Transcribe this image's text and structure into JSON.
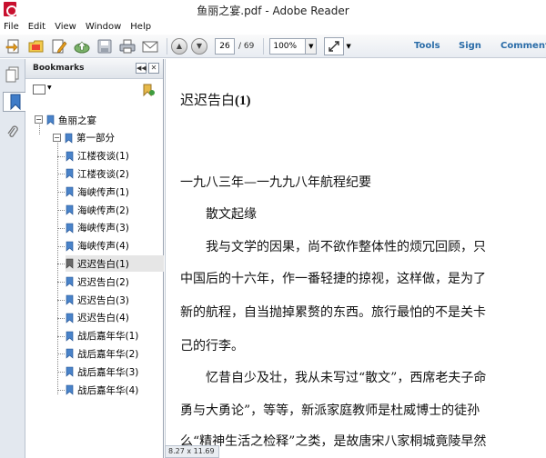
{
  "window": {
    "title": "鱼丽之宴.pdf - Adobe Reader"
  },
  "menu": [
    "File",
    "Edit",
    "View",
    "Window",
    "Help"
  ],
  "toolbar": {
    "current_page": "26",
    "total_pages": "/ 69",
    "zoom": "100%",
    "tools_label": "Tools",
    "sign_label": "Sign",
    "comment_label": "Comment"
  },
  "bookmarks": {
    "title": "Bookmarks",
    "tree": [
      {
        "label": "鱼丽之宴",
        "level": 0,
        "expandable": true,
        "selected": false
      },
      {
        "label": "第一部分",
        "level": 1,
        "expandable": true,
        "selected": false
      },
      {
        "label": "江楼夜谈(1)",
        "level": 2,
        "expandable": false,
        "selected": false
      },
      {
        "label": "江楼夜谈(2)",
        "level": 2,
        "expandable": false,
        "selected": false
      },
      {
        "label": "海峡传声(1)",
        "level": 2,
        "expandable": false,
        "selected": false
      },
      {
        "label": "海峡传声(2)",
        "level": 2,
        "expandable": false,
        "selected": false
      },
      {
        "label": "海峡传声(3)",
        "level": 2,
        "expandable": false,
        "selected": false
      },
      {
        "label": "海峡传声(4)",
        "level": 2,
        "expandable": false,
        "selected": false
      },
      {
        "label": "迟迟告白(1)",
        "level": 2,
        "expandable": false,
        "selected": true
      },
      {
        "label": "迟迟告白(2)",
        "level": 2,
        "expandable": false,
        "selected": false
      },
      {
        "label": "迟迟告白(3)",
        "level": 2,
        "expandable": false,
        "selected": false
      },
      {
        "label": "迟迟告白(4)",
        "level": 2,
        "expandable": false,
        "selected": false
      },
      {
        "label": "战后嘉年华(1)",
        "level": 2,
        "expandable": false,
        "selected": false
      },
      {
        "label": "战后嘉年华(2)",
        "level": 2,
        "expandable": false,
        "selected": false
      },
      {
        "label": "战后嘉年华(3)",
        "level": 2,
        "expandable": false,
        "selected": false
      },
      {
        "label": "战后嘉年华(4)",
        "level": 2,
        "expandable": false,
        "selected": false
      }
    ]
  },
  "document": {
    "heading_text": "迟迟告白",
    "heading_num": "(1)",
    "lines": [
      "一九八三年—一九九八年航程纪要",
      "　　散文起缘",
      "　　我与文学的因果，尚不欲作整体性的烦冗回顾，只",
      "中国后的十六年，作一番轻捷的掠视，这样做，是为了",
      "新的航程，自当抛掉累赘的东西。旅行最怕的不是关卡",
      "己的行李。",
      "　　忆昔自少及壮，我从未写过“散文”，西席老夫子命",
      "勇与大勇论”，等等，新派家庭教师是杜威博士的徒孙",
      "么“精神生活之检释”之类，是故唐宋八家桐城竟陵早然"
    ]
  },
  "status": {
    "page_size": "8.27 x 11.69 in"
  }
}
